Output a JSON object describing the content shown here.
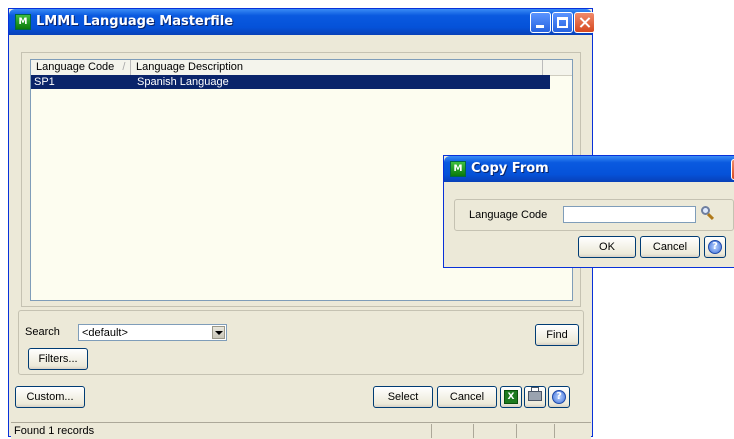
{
  "main": {
    "title": "LMML Language Masterfile",
    "columns": [
      "Language Code",
      "Language Description"
    ],
    "sort_indicator": "/",
    "rows": [
      {
        "code": "SP1",
        "description": "Spanish Language"
      }
    ],
    "search": {
      "label": "Search",
      "value": "<default>",
      "find_label": "Find",
      "filters_label": "Filters..."
    },
    "buttons": {
      "custom": "Custom...",
      "select": "Select",
      "cancel": "Cancel"
    },
    "status": "Found 1 records"
  },
  "dialog": {
    "title": "Copy From",
    "field_label": "Language Code",
    "field_value": "",
    "ok": "OK",
    "cancel": "Cancel"
  },
  "colors": {
    "titlebar": "#0552d9",
    "window_bg": "#ece9d8",
    "list_bg": "#fdfdf0",
    "selection": "#0a246a"
  }
}
